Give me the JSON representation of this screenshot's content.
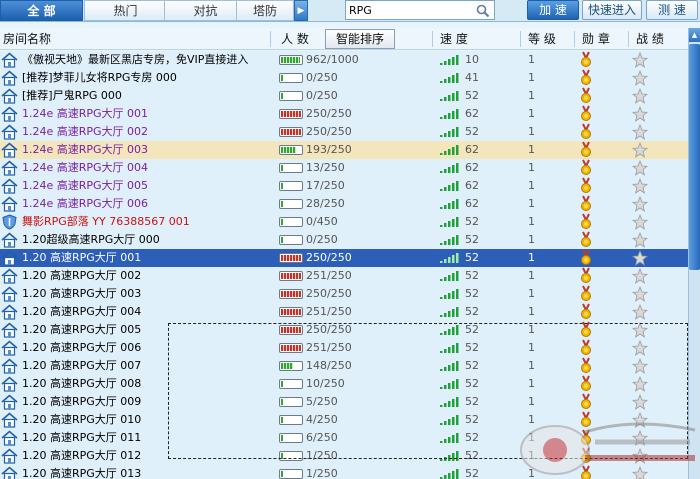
{
  "tabs": [
    {
      "label": "全 部",
      "active": true
    },
    {
      "label": "热门",
      "active": false
    },
    {
      "label": "对抗",
      "active": false
    },
    {
      "label": "塔防",
      "active": false
    }
  ],
  "tab_scroll_glyph": "▶",
  "search": {
    "value": "RPG"
  },
  "buttons": {
    "speed": "加 速",
    "quick_enter": "快速进入",
    "test_speed": "测 速"
  },
  "header": {
    "room_name": "房间名称",
    "people": "人 数",
    "smart_sort": "智能排序",
    "speed": "速 度",
    "level": "等 级",
    "medal": "勋 章",
    "record": "战 绩"
  },
  "colors": {
    "purple_name": "#7a1fa2",
    "red_name": "#cc1111",
    "selected_row": "#2d5fb8",
    "hover_row": "#f3e6bd",
    "fill_green": "#2fa62f",
    "fill_red": "#c5332b"
  },
  "rows": [
    {
      "name": "《傲视天地》最新区黑店专房，免VIP直接进入",
      "count": "962/1000",
      "fill": 0.96,
      "fill_color": "green",
      "speed": "10",
      "level": "1",
      "name_color": "default",
      "icon": "house-icon",
      "state": "normal"
    },
    {
      "name": "[推荐]梦菲儿女将RPG专房 000",
      "count": "0/250",
      "fill": 0.0,
      "fill_color": "green",
      "speed": "41",
      "level": "1",
      "name_color": "default",
      "icon": "house-icon",
      "state": "normal"
    },
    {
      "name": "[推荐]尸鬼RPG 000",
      "count": "0/250",
      "fill": 0.0,
      "fill_color": "green",
      "speed": "52",
      "level": "1",
      "name_color": "default",
      "icon": "house-icon",
      "state": "normal"
    },
    {
      "name": "1.24e 高速RPG大厅 001",
      "count": "250/250",
      "fill": 1.0,
      "fill_color": "red",
      "speed": "62",
      "level": "1",
      "name_color": "purple",
      "icon": "house-icon",
      "state": "normal"
    },
    {
      "name": "1.24e 高速RPG大厅 002",
      "count": "250/250",
      "fill": 1.0,
      "fill_color": "red",
      "speed": "52",
      "level": "1",
      "name_color": "purple",
      "icon": "house-icon",
      "state": "normal"
    },
    {
      "name": "1.24e 高速RPG大厅 003",
      "count": "193/250",
      "fill": 0.77,
      "fill_color": "green",
      "speed": "62",
      "level": "1",
      "name_color": "purple",
      "icon": "house-icon",
      "state": "hover"
    },
    {
      "name": "1.24e 高速RPG大厅 004",
      "count": "13/250",
      "fill": 0.05,
      "fill_color": "green",
      "speed": "62",
      "level": "1",
      "name_color": "purple",
      "icon": "house-icon",
      "state": "normal"
    },
    {
      "name": "1.24e 高速RPG大厅 005",
      "count": "17/250",
      "fill": 0.07,
      "fill_color": "green",
      "speed": "62",
      "level": "1",
      "name_color": "purple",
      "icon": "house-icon",
      "state": "normal"
    },
    {
      "name": "1.24e 高速RPG大厅 006",
      "count": "28/250",
      "fill": 0.11,
      "fill_color": "green",
      "speed": "62",
      "level": "1",
      "name_color": "purple",
      "icon": "house-icon",
      "state": "normal"
    },
    {
      "name": "舞影RPG部落 YY 76388567 001",
      "count": "0/450",
      "fill": 0.0,
      "fill_color": "green",
      "speed": "52",
      "level": "1",
      "name_color": "red",
      "icon": "shield-icon",
      "state": "normal"
    },
    {
      "name": "1.20超级高速RPG大厅 000",
      "count": "0/250",
      "fill": 0.0,
      "fill_color": "green",
      "speed": "52",
      "level": "1",
      "name_color": "default",
      "icon": "house-icon",
      "state": "normal"
    },
    {
      "name": "1.20 高速RPG大厅 001",
      "count": "250/250",
      "fill": 1.0,
      "fill_color": "red",
      "speed": "52",
      "level": "1",
      "name_color": "default",
      "icon": "house-icon",
      "state": "selected"
    },
    {
      "name": "1.20 高速RPG大厅 002",
      "count": "251/250",
      "fill": 1.0,
      "fill_color": "red",
      "speed": "52",
      "level": "1",
      "name_color": "default",
      "icon": "house-icon",
      "state": "normal"
    },
    {
      "name": "1.20 高速RPG大厅 003",
      "count": "250/250",
      "fill": 1.0,
      "fill_color": "red",
      "speed": "52",
      "level": "1",
      "name_color": "default",
      "icon": "house-icon",
      "state": "normal"
    },
    {
      "name": "1.20 高速RPG大厅 004",
      "count": "251/250",
      "fill": 1.0,
      "fill_color": "red",
      "speed": "52",
      "level": "1",
      "name_color": "default",
      "icon": "house-icon",
      "state": "normal"
    },
    {
      "name": "1.20 高速RPG大厅 005",
      "count": "250/250",
      "fill": 1.0,
      "fill_color": "red",
      "speed": "52",
      "level": "1",
      "name_color": "default",
      "icon": "house-icon",
      "state": "normal"
    },
    {
      "name": "1.20 高速RPG大厅 006",
      "count": "251/250",
      "fill": 1.0,
      "fill_color": "red",
      "speed": "52",
      "level": "1",
      "name_color": "default",
      "icon": "house-icon",
      "state": "normal"
    },
    {
      "name": "1.20 高速RPG大厅 007",
      "count": "148/250",
      "fill": 0.59,
      "fill_color": "green",
      "speed": "52",
      "level": "1",
      "name_color": "default",
      "icon": "house-icon",
      "state": "normal"
    },
    {
      "name": "1.20 高速RPG大厅 008",
      "count": "10/250",
      "fill": 0.04,
      "fill_color": "green",
      "speed": "52",
      "level": "1",
      "name_color": "default",
      "icon": "house-icon",
      "state": "normal"
    },
    {
      "name": "1.20 高速RPG大厅 009",
      "count": "5/250",
      "fill": 0.02,
      "fill_color": "green",
      "speed": "52",
      "level": "1",
      "name_color": "default",
      "icon": "house-icon",
      "state": "normal"
    },
    {
      "name": "1.20 高速RPG大厅 010",
      "count": "4/250",
      "fill": 0.02,
      "fill_color": "green",
      "speed": "52",
      "level": "1",
      "name_color": "default",
      "icon": "house-icon",
      "state": "normal"
    },
    {
      "name": "1.20 高速RPG大厅 011",
      "count": "6/250",
      "fill": 0.02,
      "fill_color": "green",
      "speed": "52",
      "level": "1",
      "name_color": "default",
      "icon": "house-icon",
      "state": "normal"
    },
    {
      "name": "1.20 高速RPG大厅 012",
      "count": "1/250",
      "fill": 0.01,
      "fill_color": "green",
      "speed": "52",
      "level": "1",
      "name_color": "default",
      "icon": "house-icon",
      "state": "normal"
    },
    {
      "name": "1.20 高速RPG大厅 013",
      "count": "1/250",
      "fill": 0.01,
      "fill_color": "green",
      "speed": "52",
      "level": "1",
      "name_color": "default",
      "icon": "house-icon",
      "state": "normal"
    }
  ]
}
